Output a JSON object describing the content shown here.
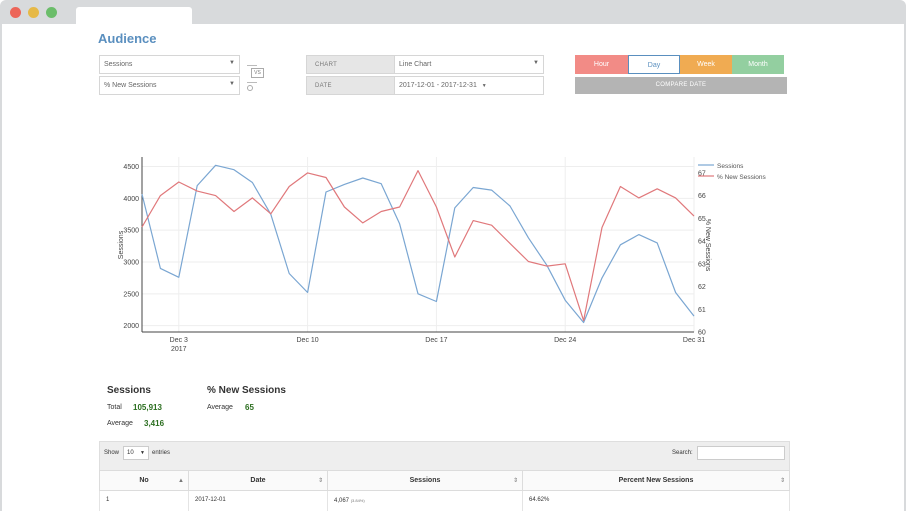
{
  "page": {
    "title": "Audience"
  },
  "controls": {
    "metric1": "Sessions",
    "metric2": "% New Sessions",
    "vs_label": "VS",
    "chart_label": "CHART",
    "chart_value": "Line Chart",
    "date_label": "DATE",
    "date_value": "2017-12-01 - 2017-12-31",
    "periods": [
      {
        "label": "Hour",
        "color": "#f28b86"
      },
      {
        "label": "Day",
        "color": "#ffffff"
      },
      {
        "label": "Week",
        "color": "#f0ab52"
      },
      {
        "label": "Month",
        "color": "#93cfa0"
      }
    ],
    "compare_label": "COMPARE DATE"
  },
  "chart_data": {
    "type": "line",
    "x": [
      "2017-12-01",
      "2017-12-02",
      "2017-12-03",
      "2017-12-04",
      "2017-12-05",
      "2017-12-06",
      "2017-12-07",
      "2017-12-08",
      "2017-12-09",
      "2017-12-10",
      "2017-12-11",
      "2017-12-12",
      "2017-12-13",
      "2017-12-14",
      "2017-12-15",
      "2017-12-16",
      "2017-12-17",
      "2017-12-18",
      "2017-12-19",
      "2017-12-20",
      "2017-12-21",
      "2017-12-22",
      "2017-12-23",
      "2017-12-24",
      "2017-12-25",
      "2017-12-26",
      "2017-12-27",
      "2017-12-28",
      "2017-12-29",
      "2017-12-30",
      "2017-12-31"
    ],
    "x_ticks": [
      {
        "date": "2017-12-03",
        "label": "Dec 3",
        "sub": "2017"
      },
      {
        "date": "2017-12-10",
        "label": "Dec 10",
        "sub": ""
      },
      {
        "date": "2017-12-17",
        "label": "Dec 17",
        "sub": ""
      },
      {
        "date": "2017-12-24",
        "label": "Dec 24",
        "sub": ""
      },
      {
        "date": "2017-12-31",
        "label": "Dec 31",
        "sub": ""
      }
    ],
    "series": [
      {
        "name": "Sessions",
        "axis": "left",
        "color": "#7aa6d2",
        "values": [
          4067,
          2900,
          2760,
          4200,
          4520,
          4450,
          4250,
          3750,
          2820,
          2520,
          4100,
          4220,
          4320,
          4230,
          3600,
          2500,
          2380,
          3850,
          4170,
          4130,
          3880,
          3380,
          2950,
          2400,
          2050,
          2750,
          3270,
          3430,
          3300,
          2520,
          2150
        ]
      },
      {
        "name": "% New Sessions",
        "axis": "right",
        "color": "#e0787b",
        "values": [
          64.62,
          66.0,
          66.6,
          66.2,
          66.0,
          65.3,
          65.9,
          65.2,
          66.4,
          67.0,
          66.8,
          65.5,
          64.8,
          65.3,
          65.5,
          67.1,
          65.5,
          63.3,
          64.9,
          64.7,
          63.9,
          63.1,
          62.9,
          63.0,
          60.5,
          64.6,
          66.4,
          65.9,
          66.3,
          65.9,
          65.1
        ]
      }
    ],
    "ylabel": "Sessions",
    "y2label": "% New Sessions",
    "ylim": [
      1900,
      4650
    ],
    "y_ticks": [
      2000,
      2500,
      3000,
      3500,
      4000,
      4500
    ],
    "y2lim": [
      60,
      67.7
    ],
    "y2_ticks": [
      60,
      61,
      62,
      63,
      64,
      65,
      66,
      67
    ],
    "grid": true,
    "legend": "top-right"
  },
  "summary": {
    "sessions": {
      "title": "Sessions",
      "total_label": "Total",
      "total": "105,913",
      "average_label": "Average",
      "average": "3,416"
    },
    "new_sessions": {
      "title": "% New Sessions",
      "average_label": "Average",
      "average": "65"
    }
  },
  "table": {
    "show_label": "Show",
    "page_size": "10",
    "entries_label": "entries",
    "search_label": "Search:",
    "columns": [
      "No",
      "Date",
      "Sessions",
      "Percent New Sessions"
    ],
    "rows": [
      {
        "no": "1",
        "date": "2017-12-01",
        "sessions": "4,067",
        "sessions_pct": "(3.84%)",
        "pct_new": "64.62%"
      }
    ]
  }
}
